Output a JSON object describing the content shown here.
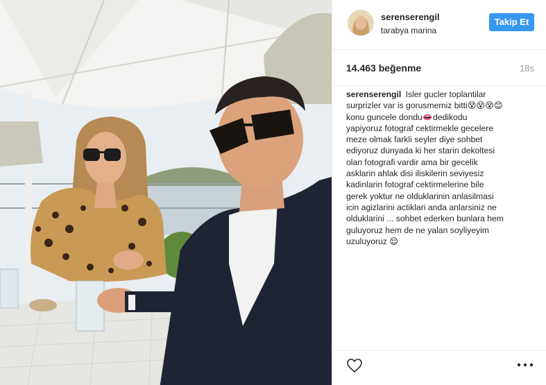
{
  "post": {
    "username": "serenserengil",
    "location": "tarabya marina",
    "follow_label": "Takip Et",
    "likes": "14.463 beğenme",
    "time_ago": "18s",
    "caption_user": "serenserengil",
    "caption_lines": [
      "Isler gucler toplantilar",
      "surprizler var is gorusmemiz bitti😵😵😵😊",
      "konu guncele dondu👄dedikodu",
      "yapiyoruz fotograf cektirmekle gecelere",
      "meze olmak farkli seyler diye sohbet",
      "ediyoruz dunyada ki her starin dekoltesi",
      "olan fotografi vardir ama bir gecelik",
      "asklarin ahlak disi iliskilerin seviyesiz",
      "kadinlarin fotograf cektirmelerine bile",
      "gerek yoktur ne olduklarinin anlasilmasi",
      "icin agizlarini actiklari anda anlarsiniz ne",
      "olduklarini ... sohbet ederken bunlara hem",
      "guluyoruz hem de ne yalan soyliyeyim",
      "uzuluyoruz 😌"
    ]
  },
  "icons": {
    "heart": "heart-outline-icon",
    "more": "more-options-icon"
  },
  "colors": {
    "follow_button": "#3897f0",
    "text": "#262626",
    "muted": "#999999"
  }
}
